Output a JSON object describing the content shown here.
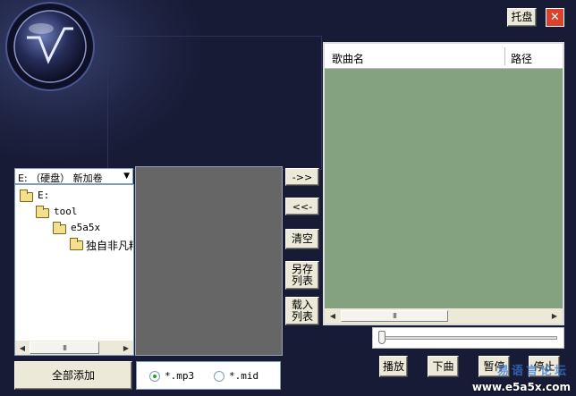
{
  "titlebar": {
    "tray_label": "托盘",
    "close_glyph": "✕"
  },
  "logo": {
    "text": "Vs"
  },
  "drive_select": {
    "value": "E: （硬盘） 新加卷"
  },
  "tree": [
    {
      "label": "E:"
    },
    {
      "label": "tool"
    },
    {
      "label": "e5a5x"
    },
    {
      "label": "独自非凡精"
    }
  ],
  "middle_buttons": {
    "add": "->>",
    "remove": "<<-",
    "clear": "清空",
    "save_list": "另存\n列表",
    "load_list": "载入\n列表"
  },
  "playlist": {
    "col_song": "歌曲名",
    "col_path": "路径"
  },
  "add_all_label": "全部添加",
  "filters": [
    {
      "label": "*.mp3",
      "selected": true
    },
    {
      "label": "*.mid",
      "selected": false
    }
  ],
  "controls": {
    "play": "播放",
    "next": "下曲",
    "pause": "暂停",
    "stop": "停止"
  },
  "progress": {
    "fraction": 0.0
  },
  "watermark": {
    "line1": "易语言论坛",
    "line2": "www.e5a5x.com"
  },
  "scroll_grip": "III",
  "colors": {
    "playlist_bg": "#84a280",
    "file_panel_bg": "#666666",
    "accent_red": "#d9432c"
  }
}
